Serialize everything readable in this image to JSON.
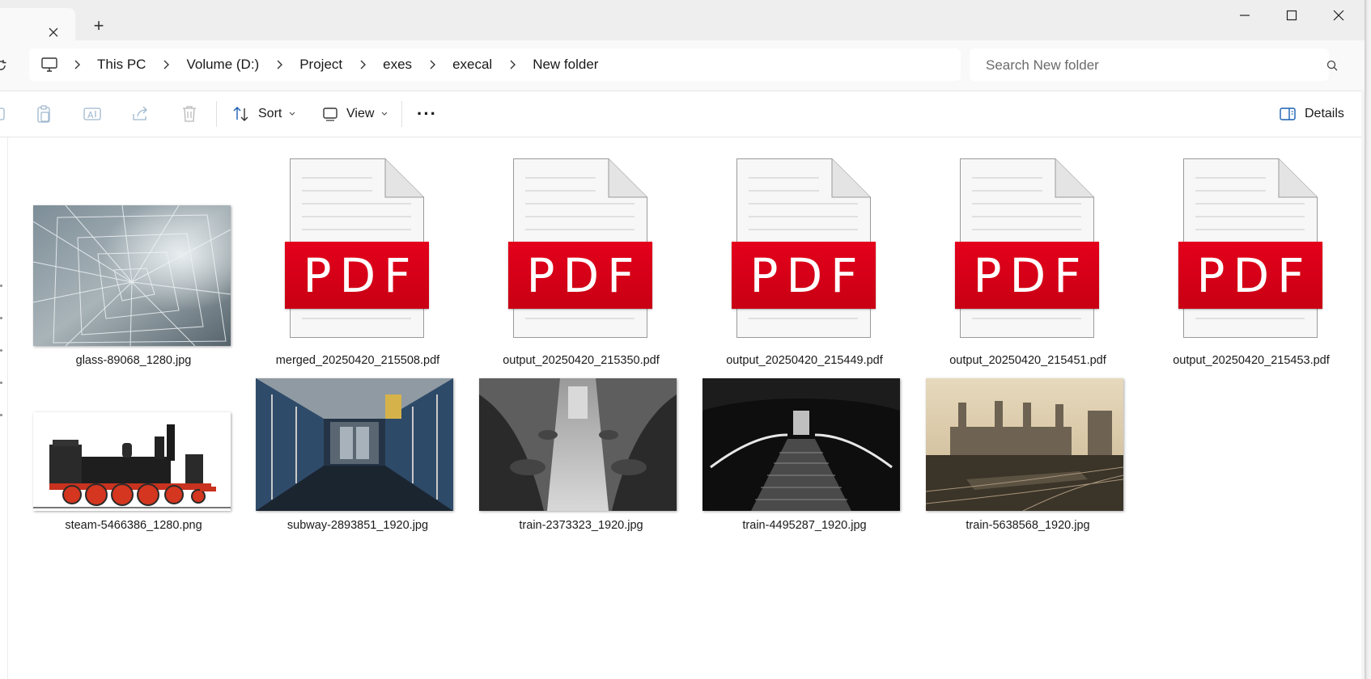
{
  "titlebar": {
    "new_tab_symbol": "+",
    "window_controls": [
      "minimize-icon",
      "maximize-icon",
      "close-icon"
    ]
  },
  "breadcrumb": {
    "items": [
      "This PC",
      "Volume (D:)",
      "Project",
      "exes",
      "execal",
      "New folder"
    ]
  },
  "search": {
    "placeholder": "Search New folder"
  },
  "commandbar": {
    "icons": [
      "copy-icon",
      "paste-icon",
      "rename-icon",
      "share-icon",
      "delete-icon"
    ],
    "sort_label": "Sort",
    "view_label": "View",
    "more_symbol": "···",
    "details_label": "Details"
  },
  "files": [
    {
      "name": "glass-89068_1280.jpg",
      "type": "image",
      "thumb": "shattered-glass"
    },
    {
      "name": "merged_20250420_215508.pdf",
      "type": "pdf"
    },
    {
      "name": "output_20250420_215350.pdf",
      "type": "pdf"
    },
    {
      "name": "output_20250420_215449.pdf",
      "type": "pdf"
    },
    {
      "name": "output_20250420_215451.pdf",
      "type": "pdf"
    },
    {
      "name": "output_20250420_215453.pdf",
      "type": "pdf"
    },
    {
      "name": "steam-5466386_1280.png",
      "type": "image",
      "thumb": "steam-locomotive"
    },
    {
      "name": "subway-2893851_1920.jpg",
      "type": "image",
      "thumb": "subway-car-interior"
    },
    {
      "name": "train-2373323_1920.jpg",
      "type": "image",
      "thumb": "train-passengers-bw"
    },
    {
      "name": "train-4495287_1920.jpg",
      "type": "image",
      "thumb": "station-escalator"
    },
    {
      "name": "train-5638568_1920.jpg",
      "type": "image",
      "thumb": "power-station-tracks"
    }
  ],
  "pdf_badge_text": "PDF",
  "colors": {
    "pdf_red": "#d7001a",
    "accent_blue": "#0067c0",
    "titlebar_bg": "#eeeeee",
    "toolbar_bg": "#f9f9f9"
  }
}
